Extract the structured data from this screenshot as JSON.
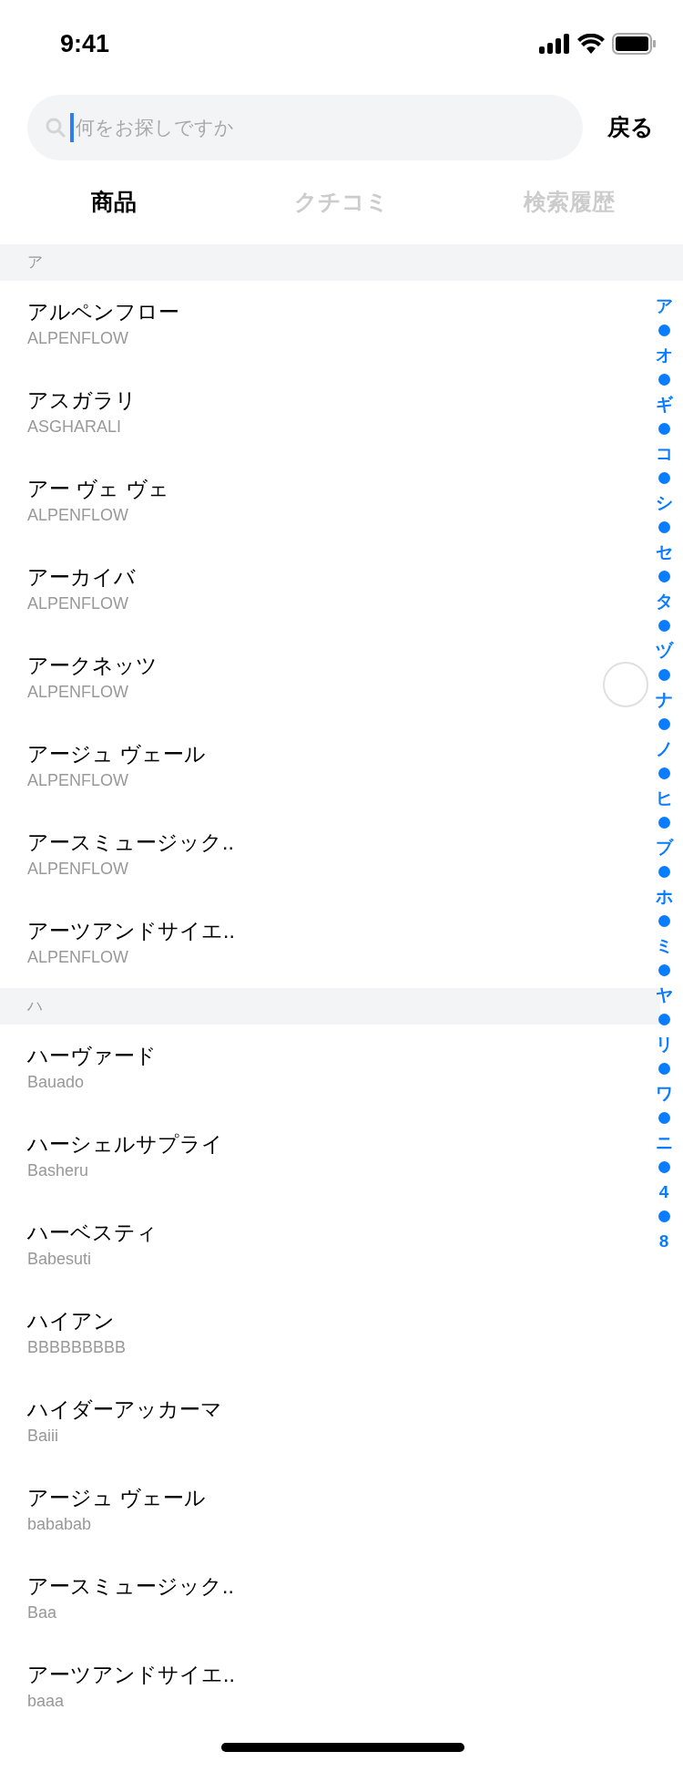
{
  "status_bar": {
    "time": "9:41"
  },
  "search": {
    "placeholder": "何をお探しですか",
    "focused": true,
    "back": "戻る"
  },
  "tabs": [
    {
      "label": "商品",
      "selected": true
    },
    {
      "label": "クチコミ",
      "selected": false
    },
    {
      "label": "検索履歴",
      "selected": false
    }
  ],
  "sections": [
    {
      "header": "ア",
      "items": [
        {
          "name": "アルペンフロー",
          "sub": "ALPENFLOW"
        },
        {
          "name": "アスガラリ",
          "sub": "ASGHARALI"
        },
        {
          "name": "アー ヴェ ヴェ",
          "sub": "ALPENFLOW"
        },
        {
          "name": "アーカイバ",
          "sub": "ALPENFLOW"
        },
        {
          "name": "アークネッツ",
          "sub": "ALPENFLOW"
        },
        {
          "name": "アージュ ヴェール",
          "sub": "ALPENFLOW"
        },
        {
          "name": "アースミュージック..",
          "sub": "ALPENFLOW"
        },
        {
          "name": "アーツアンドサイエ..",
          "sub": "ALPENFLOW"
        }
      ]
    },
    {
      "header": "ハ",
      "items": [
        {
          "name": "ハーヴァード",
          "sub": "Bauado"
        },
        {
          "name": "ハーシェルサプライ",
          "sub": "Basheru"
        },
        {
          "name": "ハーベスティ",
          "sub": "Babesuti"
        },
        {
          "name": "ハイアン",
          "sub": "BBBBBBBBB"
        },
        {
          "name": "ハイダーアッカーマ",
          "sub": "Baiii"
        },
        {
          "name": "アージュ ヴェール",
          "sub": "bababab"
        },
        {
          "name": "アースミュージック..",
          "sub": "Baa"
        },
        {
          "name": "アーツアンドサイエ..",
          "sub": "baaa"
        }
      ]
    }
  ],
  "index": [
    "ア",
    "オ",
    "ギ",
    "コ",
    "シ",
    "セ",
    "タ",
    "ヅ",
    "ナ",
    "ノ",
    "ヒ",
    "ブ",
    "ホ",
    "ミ",
    "ヤ",
    "リ",
    "ワ",
    "ニ",
    "4",
    "8"
  ]
}
